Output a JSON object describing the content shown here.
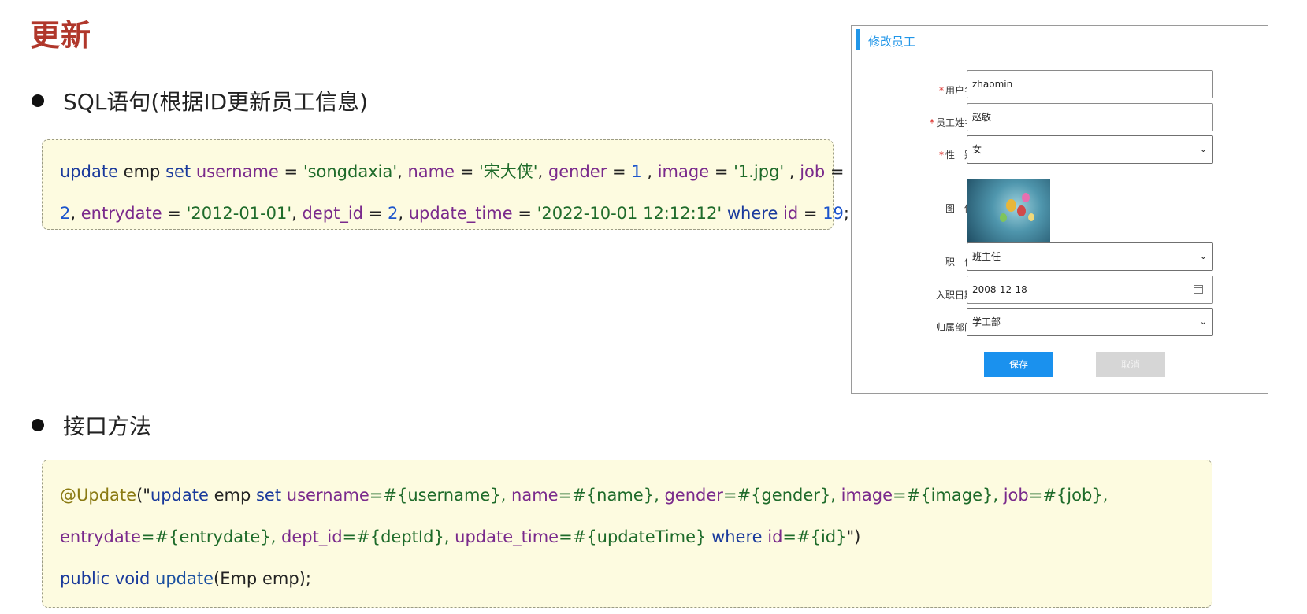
{
  "page": {
    "title": "更新"
  },
  "sections": [
    {
      "label": "SQL语句(根据ID更新员工信息)"
    },
    {
      "label": "接口方法"
    }
  ],
  "sql_block": {
    "lines": [
      [
        {
          "t": "update",
          "c": "kw"
        },
        {
          "t": " emp ",
          "c": ""
        },
        {
          "t": "set",
          "c": "kw"
        },
        {
          "t": " ",
          "c": ""
        },
        {
          "t": "username",
          "c": "fld"
        },
        {
          "t": " = ",
          "c": ""
        },
        {
          "t": "'songdaxia'",
          "c": "str"
        },
        {
          "t": ", ",
          "c": ""
        },
        {
          "t": "name",
          "c": "fld"
        },
        {
          "t": " = ",
          "c": ""
        },
        {
          "t": "'宋大侠'",
          "c": "str"
        },
        {
          "t": ", ",
          "c": ""
        },
        {
          "t": "gender",
          "c": "fld"
        },
        {
          "t": " = ",
          "c": ""
        },
        {
          "t": "1",
          "c": "num"
        },
        {
          "t": " , ",
          "c": ""
        },
        {
          "t": "image",
          "c": "fld"
        },
        {
          "t": " = ",
          "c": ""
        },
        {
          "t": "'1.jpg'",
          "c": "str"
        },
        {
          "t": " , ",
          "c": ""
        },
        {
          "t": "job",
          "c": "fld"
        },
        {
          "t": " =",
          "c": ""
        }
      ],
      [
        {
          "t": "2",
          "c": "num"
        },
        {
          "t": ", ",
          "c": ""
        },
        {
          "t": "entrydate",
          "c": "fld"
        },
        {
          "t": " = ",
          "c": ""
        },
        {
          "t": "'2012-01-01'",
          "c": "str"
        },
        {
          "t": ", ",
          "c": ""
        },
        {
          "t": "dept_id",
          "c": "fld"
        },
        {
          "t": " = ",
          "c": ""
        },
        {
          "t": "2",
          "c": "num"
        },
        {
          "t": ", ",
          "c": ""
        },
        {
          "t": "update_time",
          "c": "fld"
        },
        {
          "t": " = ",
          "c": ""
        },
        {
          "t": "'2022-10-01 12:12:12'",
          "c": "str"
        },
        {
          "t": " ",
          "c": ""
        },
        {
          "t": "where",
          "c": "kw"
        },
        {
          "t": " ",
          "c": ""
        },
        {
          "t": "id",
          "c": "fld"
        },
        {
          "t": " = ",
          "c": ""
        },
        {
          "t": "19",
          "c": "num"
        },
        {
          "t": ";",
          "c": ""
        }
      ]
    ]
  },
  "java_block": {
    "lines": [
      [
        {
          "t": "@Update",
          "c": "ann"
        },
        {
          "t": "(\"",
          "c": ""
        },
        {
          "t": "update",
          "c": "kw"
        },
        {
          "t": " emp ",
          "c": ""
        },
        {
          "t": "set",
          "c": "kw"
        },
        {
          "t": " ",
          "c": ""
        },
        {
          "t": "username",
          "c": "fld"
        },
        {
          "t": "=#{username}, ",
          "c": "str"
        },
        {
          "t": "name",
          "c": "fld"
        },
        {
          "t": "=#{name}, ",
          "c": "str"
        },
        {
          "t": "gender",
          "c": "fld"
        },
        {
          "t": "=#{gender}, ",
          "c": "str"
        },
        {
          "t": "image",
          "c": "fld"
        },
        {
          "t": "=#{image}, ",
          "c": "str"
        },
        {
          "t": "job",
          "c": "fld"
        },
        {
          "t": "=#{job},",
          "c": "str"
        }
      ],
      [
        {
          "t": "entrydate",
          "c": "fld"
        },
        {
          "t": "=#{entrydate}, ",
          "c": "str"
        },
        {
          "t": "dept_id",
          "c": "fld"
        },
        {
          "t": "=#{deptId}, ",
          "c": "str"
        },
        {
          "t": "update_time",
          "c": "fld"
        },
        {
          "t": "=#{updateTime} ",
          "c": "str"
        },
        {
          "t": "where",
          "c": "kw"
        },
        {
          "t": " ",
          "c": ""
        },
        {
          "t": "id",
          "c": "fld"
        },
        {
          "t": "=#{id}",
          "c": "str"
        },
        {
          "t": "\")",
          "c": ""
        }
      ],
      [
        {
          "t": "public",
          "c": "kw"
        },
        {
          "t": " ",
          "c": ""
        },
        {
          "t": "void",
          "c": "kw"
        },
        {
          "t": " ",
          "c": ""
        },
        {
          "t": "update",
          "c": "mtd"
        },
        {
          "t": "(Emp emp);",
          "c": ""
        }
      ]
    ]
  },
  "edit_form": {
    "title": "修改员工",
    "fields": {
      "username": {
        "label": "用户名",
        "required": "*",
        "value": "zhaomin"
      },
      "name": {
        "label": "员工姓名",
        "required": "*",
        "value": "赵敏"
      },
      "gender": {
        "label": "性　别",
        "required": "*",
        "value": "女"
      },
      "image": {
        "label": "图　像"
      },
      "job": {
        "label": "职　位",
        "value": "班主任"
      },
      "entrydate": {
        "label": "入职日期",
        "value": "2008-12-18"
      },
      "dept": {
        "label": "归属部门",
        "value": "学工部"
      }
    },
    "save_label": "保存",
    "cancel_label": "取消",
    "icons": {
      "select": "chevron-down-icon",
      "date": "calendar-icon"
    }
  },
  "colors": {
    "title": "#b0372b",
    "keyword": "#1a3a9c",
    "field": "#7a2a8c",
    "string": "#1e6b2a",
    "number": "#1c55cc",
    "annotation": "#8a7a12",
    "primary_button": "#1a91ee",
    "code_bg": "#fdfbe0"
  }
}
